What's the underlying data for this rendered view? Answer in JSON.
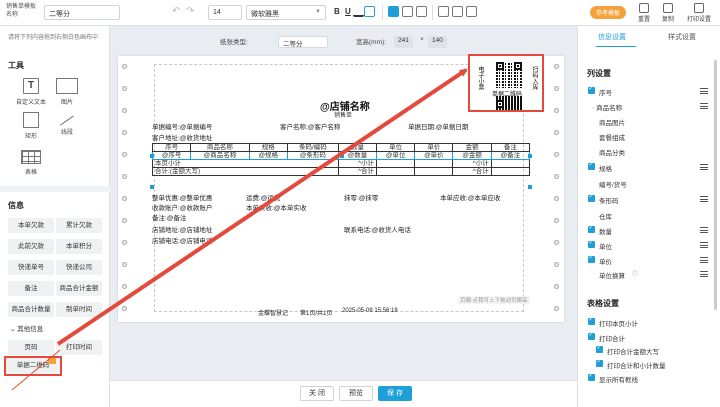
{
  "toolbar": {
    "template_label": "销售单模板名称",
    "template_name": "二等分",
    "font_size": "14",
    "font_family": "微软雅黑",
    "bold": "B",
    "underline": "U",
    "help_label": "参考模板",
    "reset_label": "重置",
    "copy_label": "复制",
    "print_label": "打印设置"
  },
  "left": {
    "hint": "请将下列内容拖到右侧白色画布中",
    "tools_title": "工具",
    "tools": [
      "自定义文本",
      "图片",
      "矩形",
      "线段",
      "表格"
    ],
    "info_title": "信息",
    "info_items": [
      "本单欠款",
      "累计欠款",
      "此前欠款",
      "本单积分",
      "快递单号",
      "快递公司",
      "备注",
      "商品合计金额",
      "商品合计数量",
      "制单时间"
    ],
    "other_title": "其他信息",
    "other_items": [
      "页码",
      "打印时间"
    ],
    "qr_item": "单据二维码"
  },
  "canvas": {
    "paper_type_label": "纸张类型:",
    "paper_type": "二等分",
    "size_label": "宽高(mm):",
    "width": "241",
    "height": "140",
    "store_name": "@店铺名称",
    "sales_note": "销售单",
    "header_lines": [
      {
        "text": "单据编号:@单据编号"
      },
      {
        "text": "客户名称:@客户名称"
      },
      {
        "text": "单据日期:@单据日期"
      },
      {
        "text": "客户地址:@收货地址"
      }
    ],
    "table_header": [
      "序号",
      "商品名称",
      "规格",
      "条码/编码",
      "数量",
      "单位",
      "单价",
      "金额",
      "备注"
    ],
    "table_row": [
      "@序号",
      "@商品名称",
      "@规格",
      "@条形码",
      "@数量",
      "@单位",
      "@单价",
      "@金额",
      "@备注"
    ],
    "subtotal_label": "本页小计",
    "subtotal_qty": "^小计",
    "subtotal_amt": "^小计",
    "total_label": "合计:(金额大写)",
    "total_qty": "^合计",
    "total_amt": "^合计",
    "footer_lines": [
      "整单优惠:@整单优惠",
      "运费:@运费",
      "抹零:@抹零",
      "本单应收:@本单应收",
      "收款账户:@收款账户",
      "本单实收:@本单实收",
      "备注:@备注",
      "店铺地址:@店铺地址",
      "联系电话:@收货人电话",
      "店铺电话:@店铺电话"
    ],
    "qr_caption": "单据二维码",
    "qr_left_text": "电子小票",
    "qr_right_text": "扫码入库",
    "page_footer": [
      "金蝶智慧记",
      "第1页/共1页",
      "2025-05-08 15:56:18"
    ],
    "scroll_hint": "页脚:点我可上下拖动页脚高"
  },
  "bottom": {
    "close": "关 闭",
    "preview": "预览",
    "save": "保 存"
  },
  "right": {
    "tabs": [
      "信息设置",
      "样式设置"
    ],
    "col_title": "列设置",
    "columns": [
      {
        "label": "序号",
        "checked": true
      },
      {
        "label": "商品名称",
        "checked": false,
        "hidden": true
      },
      {
        "label": "商品图片",
        "checked": false
      },
      {
        "label": "套餐组成",
        "checked": false
      },
      {
        "label": "商品分类",
        "checked": false
      },
      {
        "label": "规格",
        "checked": true
      },
      {
        "label": "编号/货号",
        "checked": false
      },
      {
        "label": "条形码",
        "checked": true
      },
      {
        "label": "仓库",
        "checked": false
      },
      {
        "label": "数量",
        "checked": true
      },
      {
        "label": "单位",
        "checked": true
      },
      {
        "label": "单价",
        "checked": true
      },
      {
        "label": "单位换算",
        "checked": false
      }
    ],
    "table_title": "表格设置",
    "table_opts": [
      {
        "label": "打印本页小计",
        "checked": true
      },
      {
        "label": "打印合计",
        "checked": true
      },
      {
        "label": "打印合计金额大写",
        "checked": true
      },
      {
        "label": "打印合计和小计数量",
        "checked": true
      },
      {
        "label": "显示所有框线",
        "checked": true
      }
    ]
  },
  "colors": {
    "accent": "#1e9fd8",
    "highlight": "#e44a3b",
    "help": "#f3a23a"
  }
}
